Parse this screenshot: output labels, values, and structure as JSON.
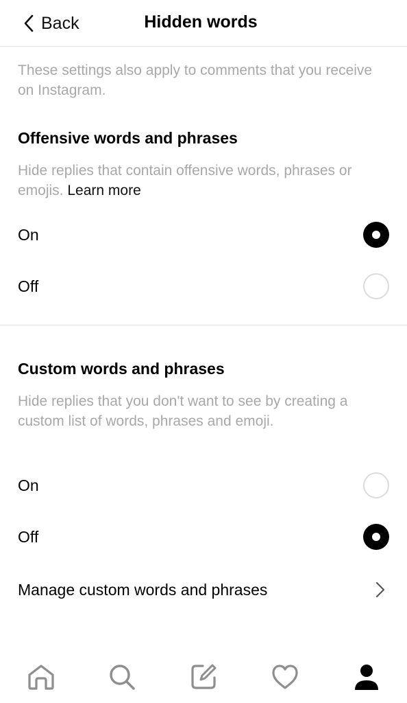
{
  "header": {
    "back_label": "Back",
    "title": "Hidden words"
  },
  "intro": "These settings also apply to comments that you receive on Instagram.",
  "offensive": {
    "title": "Offensive words and phrases",
    "description": "Hide replies that contain offensive words, phrases or emojis.",
    "learn_more": "Learn more",
    "options": [
      {
        "label": "On",
        "selected": true
      },
      {
        "label": "Off",
        "selected": false
      }
    ]
  },
  "custom": {
    "title": "Custom words and phrases",
    "description": "Hide replies that you don't want to see by creating a custom list of words, phrases and emoji.",
    "options": [
      {
        "label": "On",
        "selected": false
      },
      {
        "label": "Off",
        "selected": true
      }
    ],
    "manage_label": "Manage custom words and phrases"
  },
  "tab_bar": {
    "tabs": [
      {
        "icon": "home-icon",
        "active": false
      },
      {
        "icon": "search-icon",
        "active": false
      },
      {
        "icon": "create-icon",
        "active": false
      },
      {
        "icon": "heart-icon",
        "active": false
      },
      {
        "icon": "profile-icon",
        "active": true
      }
    ]
  },
  "colors": {
    "text": "#000000",
    "secondary_text": "#a8a8a8",
    "divider": "#e3e3e3",
    "radio_off_border": "#dbdbdb",
    "inactive_icon": "#8e8e8e"
  }
}
